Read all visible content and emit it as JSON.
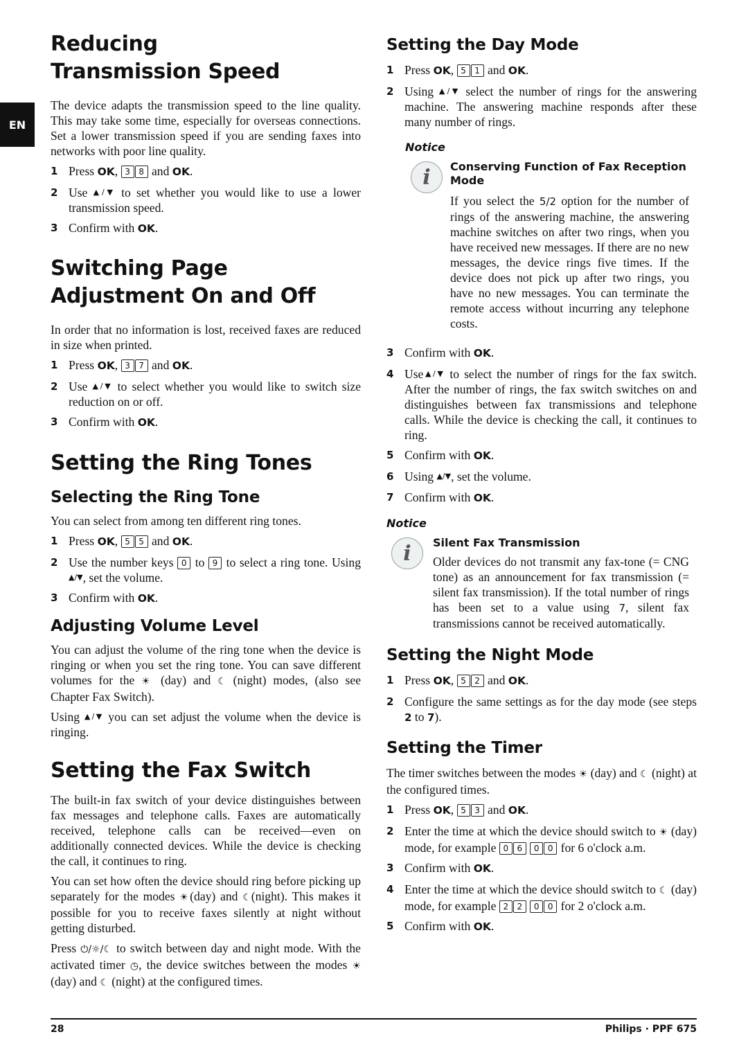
{
  "language_tab": "EN",
  "common": {
    "press": "Press",
    "ok": "OK",
    "comma": ",",
    "and": "and",
    "period": ".",
    "confirm_with": "Confirm with",
    "updown_symbol": "▲/▼",
    "day_symbol": "☀",
    "night_symbol": "☾",
    "notice_label": "Notice"
  },
  "left": {
    "reducing": {
      "title": "Reducing Transmission Speed",
      "body": "The device adapts the transmission speed to the line quality. This may take some time, especially for overseas connections. Set a lower transmission speed if you are sending faxes into networks with poor line quality.",
      "keys": [
        "3",
        "8"
      ],
      "step2_pre": "Use",
      "step2_post": "to set whether you would like to use a lower transmission speed."
    },
    "page_adjust": {
      "title": "Switching Page Adjustment On and Off",
      "body": "In order that no information is lost, received faxes are reduced in size when printed.",
      "keys": [
        "3",
        "7"
      ],
      "step2_pre": "Use",
      "step2_post": "to select whether you would like to switch size reduction on or off."
    },
    "ring_tones": {
      "title": "Setting the Ring Tones",
      "select": {
        "title": "Selecting the Ring Tone",
        "body": "You can select from among ten different ring tones.",
        "keys": [
          "5",
          "5"
        ],
        "step2_a": "Use the number keys",
        "step2_key_from": "0",
        "step2_to": "to",
        "step2_key_to": "9",
        "step2_b": "to select a ring tone. Using",
        "step2_c": ", set the volume."
      },
      "volume": {
        "title": "Adjusting Volume Level",
        "body1_a": "You can adjust the volume of the ring tone when the device is ringing or when you set the ring tone. You can save different volumes for the",
        "body1_b": "(day) and",
        "body1_c": "(night) modes, (also see Chapter Fax Switch).",
        "body2_a": "Using",
        "body2_b": "you can set adjust the volume when the device is ringing."
      }
    },
    "fax_switch": {
      "title": "Setting the Fax Switch",
      "body1": "The built-in fax switch of your device distinguishes between fax messages and telephone calls. Faxes are automatically received, telephone calls can be received—even on additionally connected devices. While the device is checking the call, it continues to ring.",
      "body2_a": "You can set how often the device should ring before picking up separately for the modes",
      "body2_b": "(day) and",
      "body2_c": "(night). This makes it possible for you to receive faxes silently at night without getting disturbed.",
      "body3_a": "Press",
      "body3_button": "⏻/☼/☾",
      "body3_b": "to switch between day and night mode. With the activated timer",
      "timer_symbol": "◷",
      "body3_c": ", the device switches between the modes",
      "body3_d": "(day) and",
      "body3_e": "(night) at the configured times."
    }
  },
  "right": {
    "day_mode": {
      "title": "Setting the Day Mode",
      "keys": [
        "5",
        "1"
      ],
      "step2_pre": "Using",
      "step2_post": "select the number of rings for the answering machine. The answering machine responds after these many number of rings.",
      "notice": {
        "title": "Conserving Function of Fax Reception Mode",
        "text_a": "If you select the",
        "option": "5/2",
        "text_b": "option for the number of rings of the answering machine, the answering machine switches on after two rings, when you have received new messages. If there are no new messages, the device rings five times. If the device does not pick up after two rings, you have no new messages. You can terminate the remote access without incurring any telephone costs."
      },
      "step4_pre": "Use",
      "step4_post": "to select the number of rings for the fax switch. After the number of rings, the fax switch switches on and distinguishes between fax transmissions and telephone calls. While the device is checking the call, it continues to ring.",
      "step6_pre": "Using",
      "step6_post": ", set the volume.",
      "notice2": {
        "title": "Silent Fax Transmission",
        "text_a": "Older devices do not transmit any fax-tone (= CNG tone) as an announcement for fax transmission (= silent fax transmission). If the total number of rings has been set to a value using",
        "value": "7",
        "text_b": ", silent fax transmissions cannot be received automatically."
      }
    },
    "night_mode": {
      "title": "Setting the Night Mode",
      "keys": [
        "5",
        "2"
      ],
      "step2_a": "Configure the same settings as for the day mode (see steps",
      "step_from": "2",
      "step2_to": "to",
      "step_to": "7",
      "step2_b": ")."
    },
    "timer": {
      "title": "Setting the Timer",
      "body_a": "The timer switches between the modes",
      "body_b": "(day) and",
      "body_c": "(night) at the configured times.",
      "keys": [
        "5",
        "3"
      ],
      "step2_a": "Enter the time at which the device should switch to",
      "step2_b": "(day) mode, for example",
      "step2_keys_h": [
        "0",
        "6"
      ],
      "step2_keys_m": [
        "0",
        "0"
      ],
      "step2_c": "for 6 o'clock a.m.",
      "step4_a": "Enter the time at which the device should switch to",
      "step4_b": "(day) mode, for example",
      "step4_keys_h": [
        "2",
        "2"
      ],
      "step4_keys_m": [
        "0",
        "0"
      ],
      "step4_c": "for 2 o'clock a.m."
    }
  },
  "footer": {
    "page_number": "28",
    "brand": "Philips · PPF 675"
  }
}
